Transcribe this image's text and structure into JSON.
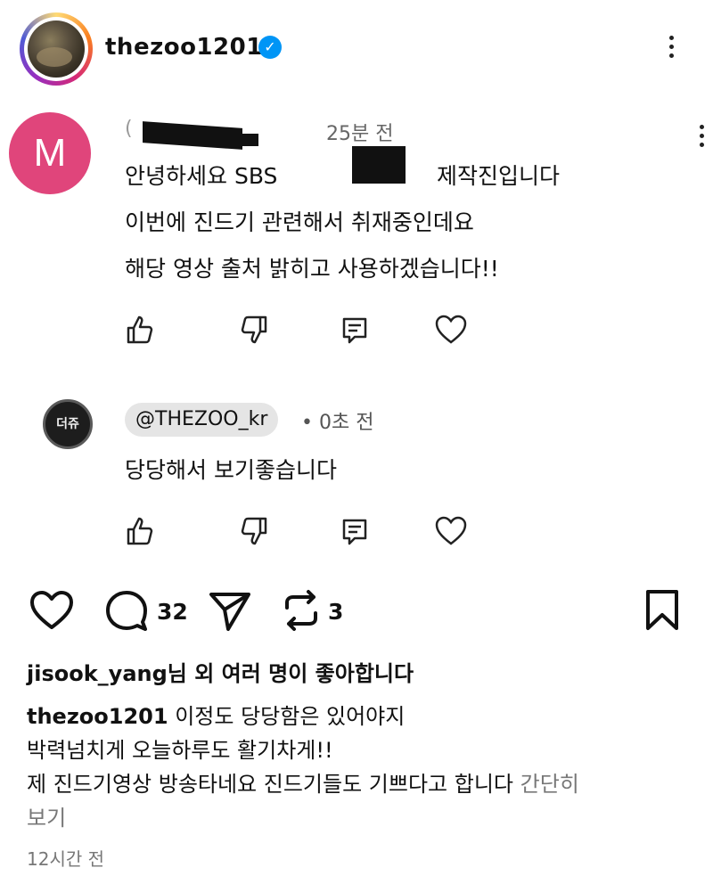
{
  "header": {
    "username": "thezoo1201",
    "verified_icon": "verified-badge-icon",
    "more_icon": "more-vertical-icon"
  },
  "comment": {
    "avatar_letter": "M",
    "avatar_color": "#e0457b",
    "time": "25분 전",
    "lines": [
      "안녕하세요 SBS",
      "제작진입니다",
      "이번에 진드기 관련해서 취재중인데요",
      "해당 영상 출처 밝히고 사용하겠습니다!!"
    ]
  },
  "reply": {
    "avatar_text": "더쥬",
    "mention": "@THEZOO_kr",
    "time": "• 0초 전",
    "text": "당당해서 보기좋습니다"
  },
  "actions": {
    "comments_count": "32",
    "reposts_count": "3"
  },
  "likes": {
    "user": "jisook_yang",
    "suffix": "님 외 여러 명이 좋아합니다"
  },
  "caption": {
    "username": "thezoo1201",
    "line1": " 이정도 당당함은 있어야지",
    "line2": "박력넘치게 오늘하루도 활기차게!!",
    "line3": "제 진드기영상 방송타네요 진드기들도 기쁘다고 합니다 ",
    "collapse": "간단히",
    "collapse2": "보기"
  },
  "timestamp": "12시간 전"
}
